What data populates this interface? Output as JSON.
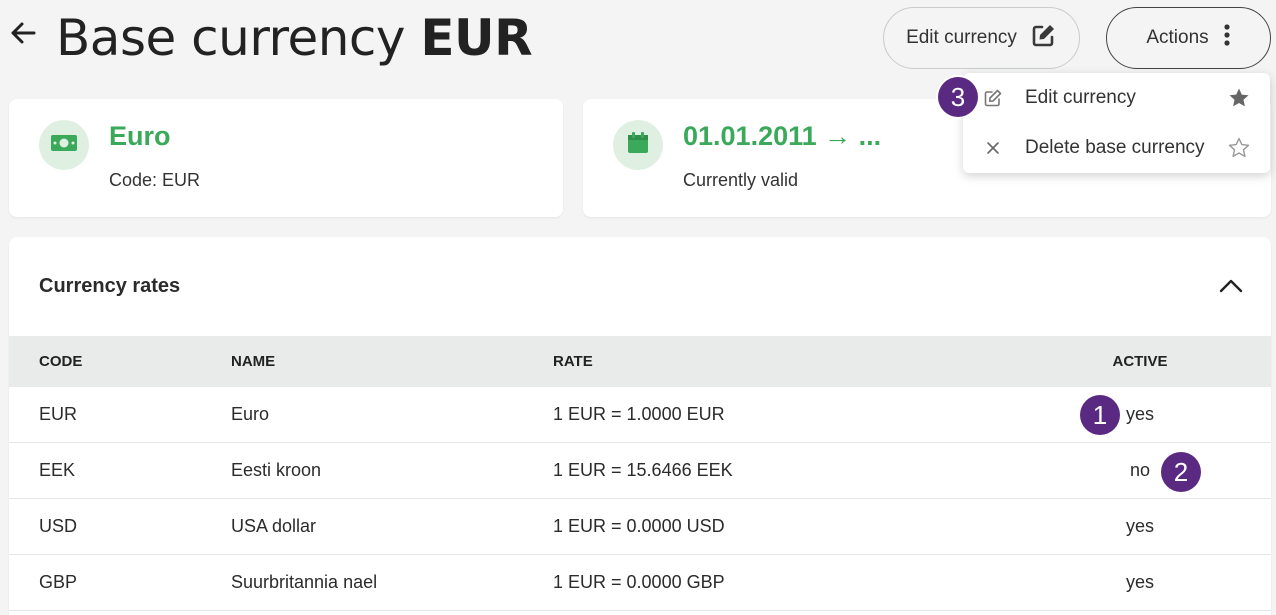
{
  "header": {
    "title_prefix": "Base currency",
    "title_code": "EUR",
    "edit_button": "Edit currency",
    "actions_button": "Actions"
  },
  "currency_card": {
    "name": "Euro",
    "code_text": "Code: EUR"
  },
  "validity_card": {
    "period": "01.01.2011 → ...",
    "status": "Currently valid"
  },
  "rates": {
    "title": "Currency rates",
    "columns": [
      "CODE",
      "NAME",
      "RATE",
      "ACTIVE"
    ],
    "rows": [
      {
        "code": "EUR",
        "name": "Euro",
        "rate": "1 EUR = 1.0000 EUR",
        "active": "yes"
      },
      {
        "code": "EEK",
        "name": "Eesti kroon",
        "rate": "1 EUR = 15.6466 EEK",
        "active": "no"
      },
      {
        "code": "USD",
        "name": "USA dollar",
        "rate": "1 EUR = 0.0000 USD",
        "active": "yes"
      },
      {
        "code": "GBP",
        "name": "Suurbritannia nael",
        "rate": "1 EUR = 0.0000 GBP",
        "active": "yes"
      }
    ]
  },
  "actions_menu": {
    "items": [
      {
        "label": "Edit currency",
        "favorite": true
      },
      {
        "label": "Delete base currency",
        "favorite": false
      }
    ]
  },
  "markers": [
    "1",
    "2",
    "3"
  ],
  "colors": {
    "accent_green": "#3aa95a",
    "marker_purple": "#5a2a82",
    "background": "#f3f4f3"
  }
}
